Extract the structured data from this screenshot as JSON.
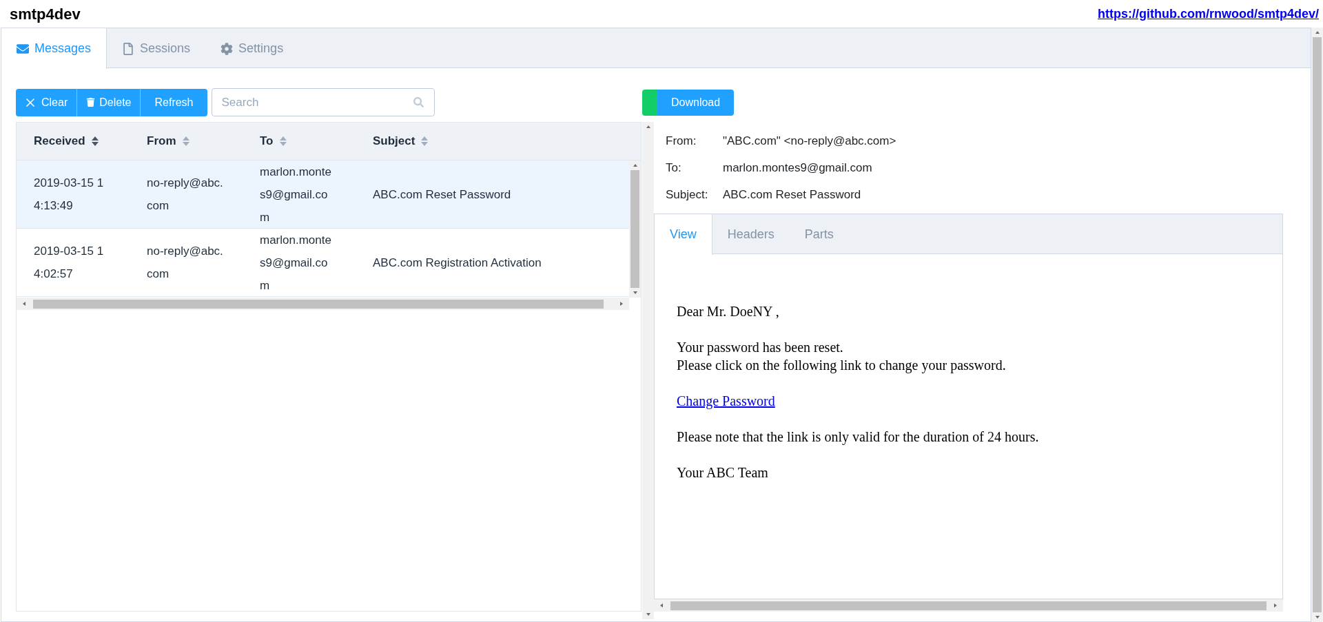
{
  "header": {
    "title": "smtp4dev",
    "link": "https://github.com/rnwood/smtp4dev/"
  },
  "tabs": [
    {
      "label": "Messages",
      "selected": true
    },
    {
      "label": "Sessions",
      "selected": false
    },
    {
      "label": "Settings",
      "selected": false
    }
  ],
  "toolbar": {
    "buttons": [
      {
        "label": "Clear"
      },
      {
        "label": "Delete"
      },
      {
        "label": "Refresh"
      }
    ],
    "search": {
      "placeholder": "Search"
    }
  },
  "table": {
    "columns": [
      {
        "label": "Received",
        "sorted": true
      },
      {
        "label": "From",
        "sorted": false
      },
      {
        "label": "To",
        "sorted": false
      },
      {
        "label": "Subject",
        "sorted": false
      }
    ],
    "rows": [
      {
        "selected": true,
        "cells": [
          "2019-03-15 14:13:49",
          "no-reply@abc.com",
          "marlon.montes9@gmail.com",
          "ABC.com Reset Password"
        ]
      },
      {
        "selected": false,
        "cells": [
          "2019-03-15 14:02:57",
          "no-reply@abc.com",
          "marlon.montes9@gmail.com",
          "ABC.com Registration Activation"
        ]
      }
    ]
  },
  "message": {
    "download": "Download",
    "fields": [
      {
        "label": "From:",
        "value": "\"ABC.com\" <no-reply@abc.com>"
      },
      {
        "label": "To:",
        "value": "marlon.montes9@gmail.com"
      },
      {
        "label": "Subject:",
        "value": "ABC.com Reset Password"
      }
    ],
    "tabs": [
      {
        "label": "View",
        "selected": true
      },
      {
        "label": "Headers",
        "selected": false
      },
      {
        "label": "Parts",
        "selected": false
      }
    ],
    "body": [
      {
        "kind": "text",
        "lines": [
          "Dear Mr. DoeNY ,"
        ]
      },
      {
        "kind": "text",
        "lines": [
          "Your password has been reset.",
          "Please click on the following link to change your password."
        ]
      },
      {
        "kind": "link",
        "lines": [
          "Change Password"
        ]
      },
      {
        "kind": "text",
        "lines": [
          "Please note that the link is only valid for the duration of 24 hours."
        ]
      },
      {
        "kind": "text",
        "lines": [
          "Your ABC Team"
        ]
      }
    ]
  }
}
